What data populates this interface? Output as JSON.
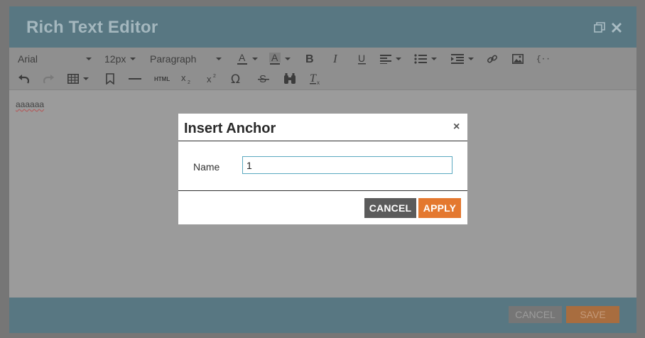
{
  "editor": {
    "title": "Rich Text Editor",
    "content_text": "aaaaaa",
    "footer": {
      "cancel_label": "CANCEL",
      "save_label": "SAVE"
    }
  },
  "toolbar": {
    "font_family": "Arial",
    "font_size": "12px",
    "block_format": "Paragraph",
    "html_label": "HTML",
    "icons_row1": [
      "font-color-icon",
      "highlight-color-icon",
      "bold-icon",
      "italic-icon",
      "underline-icon",
      "align-icon",
      "list-icon",
      "indent-icon",
      "link-icon",
      "image-icon",
      "code-icon"
    ],
    "icons_row2": [
      "undo-icon",
      "redo-icon",
      "table-icon",
      "bookmark-icon",
      "horizontal-rule-icon",
      "html-icon",
      "subscript-icon",
      "superscript-icon",
      "omega-icon",
      "strikethrough-icon",
      "find-icon",
      "clear-format-icon"
    ]
  },
  "dialog": {
    "title": "Insert Anchor",
    "close_glyph": "×",
    "name_label": "Name",
    "name_value": "1",
    "cancel_label": "CANCEL",
    "apply_label": "APPLY"
  },
  "colors": {
    "header_bg": "#587782",
    "apply_accent": "#e4782f",
    "cancel_bg": "#5b5b5b",
    "input_border": "#5aa9c0"
  }
}
